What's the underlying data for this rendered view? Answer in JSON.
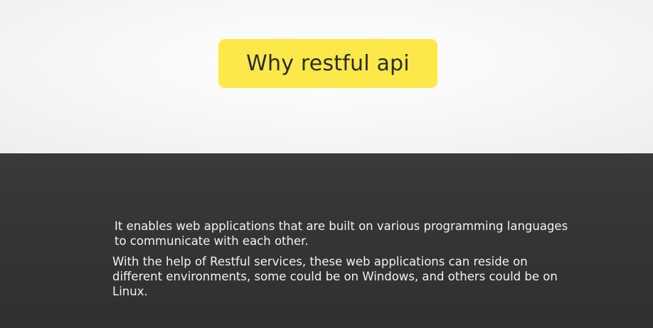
{
  "slide": {
    "title": "Why restful api",
    "paragraphs": [
      "It enables web applications that are built on various programming languages to communicate with each other.",
      "With the help of Restful services, these web applications can reside on different environments, some could be on Windows, and others could be on Linux."
    ]
  },
  "colors": {
    "title_bg": "#fde84a",
    "top_bg": "#f7f6f6",
    "bottom_bg": "#353535",
    "text_light": "#f2f2f2",
    "text_dark": "#2b2b2b"
  }
}
